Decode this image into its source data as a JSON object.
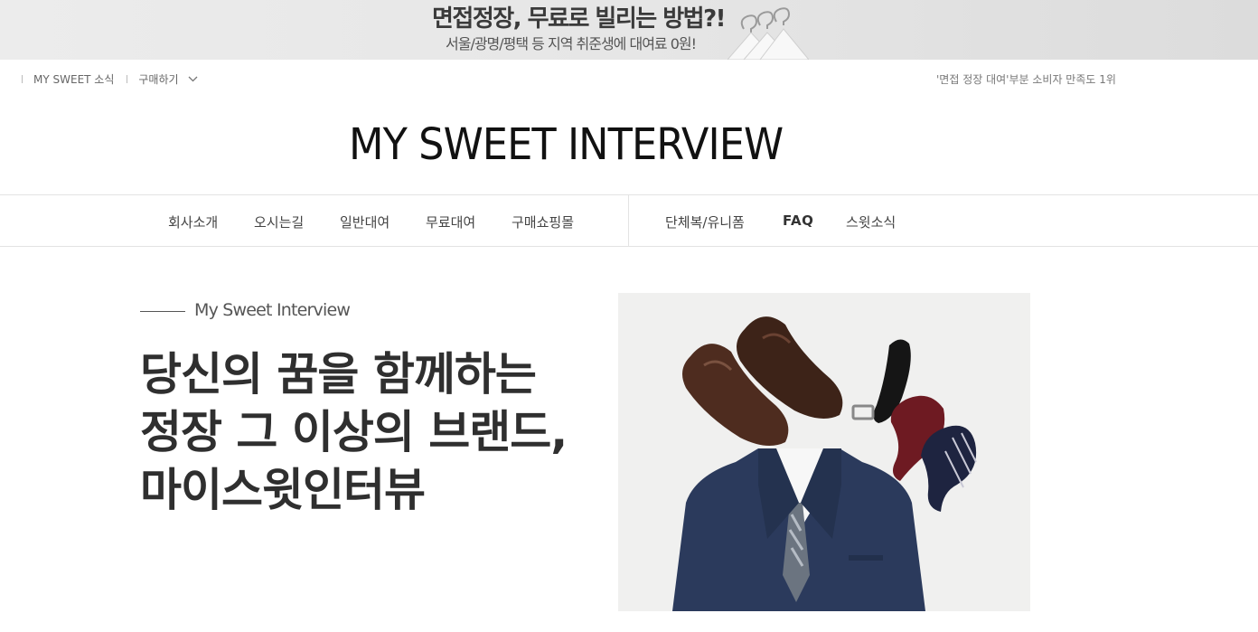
{
  "banner": {
    "title": "면접정장, 무료로 빌리는 방법?!",
    "subtitle": "서울/광명/평택 등 지역 취준생에 대여료 0원!"
  },
  "utility": {
    "news_label": "MY SWEET 소식",
    "purchase_label": "구매하기",
    "slogan": "'면접 정장 대여'부분 소비자 만족도 1위"
  },
  "logo": {
    "text": "MY SWEET INTERVIEW"
  },
  "nav": {
    "left": [
      "회사소개",
      "오시는길",
      "일반대여",
      "무료대여",
      "구매쇼핑몰"
    ],
    "right": [
      "단체복/유니폼",
      "FAQ",
      "스윗소식"
    ]
  },
  "hero": {
    "eyebrow": "My Sweet Interview",
    "headline": [
      "당신의 꿈을 함께하는",
      "정장 그 이상의 브랜드,",
      "마이스윗인터뷰"
    ]
  },
  "colors": {
    "navy_suit": "#2b3a5c",
    "shoe_brown": "#4a2a1e",
    "tie_red": "#6e1a22"
  }
}
